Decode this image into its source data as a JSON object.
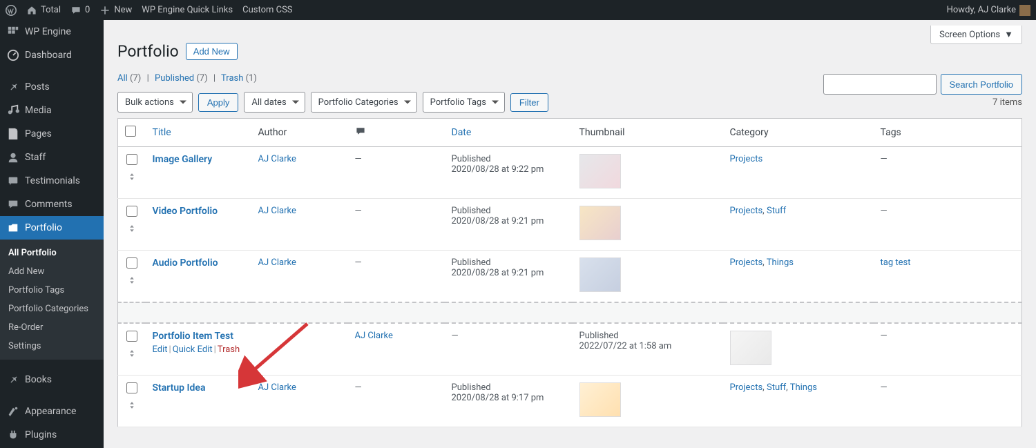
{
  "adminbar": {
    "site_name": "Total",
    "comments": "0",
    "new_label": "New",
    "quicklinks": "WP Engine Quick Links",
    "custom_css": "Custom CSS",
    "howdy": "Howdy, AJ Clarke"
  },
  "sidebar": {
    "items": [
      {
        "label": "WP Engine",
        "icon": "wpengine"
      },
      {
        "label": "Dashboard",
        "icon": "dashboard"
      },
      {
        "label": "Posts",
        "icon": "pin"
      },
      {
        "label": "Media",
        "icon": "media"
      },
      {
        "label": "Pages",
        "icon": "page"
      },
      {
        "label": "Staff",
        "icon": "user"
      },
      {
        "label": "Testimonials",
        "icon": "testimonial"
      },
      {
        "label": "Comments",
        "icon": "comment"
      },
      {
        "label": "Portfolio",
        "icon": "portfolio"
      },
      {
        "label": "Books",
        "icon": "pin"
      },
      {
        "label": "Appearance",
        "icon": "appearance"
      },
      {
        "label": "Plugins",
        "icon": "plugin"
      }
    ],
    "submenu": [
      {
        "label": "All Portfolio",
        "current": true
      },
      {
        "label": "Add New"
      },
      {
        "label": "Portfolio Tags"
      },
      {
        "label": "Portfolio Categories"
      },
      {
        "label": "Re-Order"
      },
      {
        "label": "Settings"
      }
    ]
  },
  "header": {
    "title": "Portfolio",
    "add_new": "Add New",
    "screen_options": "Screen Options"
  },
  "views": {
    "all": "All",
    "all_count": "(7)",
    "published": "Published",
    "published_count": "(7)",
    "trash": "Trash",
    "trash_count": "(1)"
  },
  "tablenav": {
    "bulk": "Bulk actions",
    "apply": "Apply",
    "dates": "All dates",
    "cats": "Portfolio Categories",
    "tags": "Portfolio Tags",
    "filter": "Filter",
    "items": "7 items"
  },
  "search": {
    "button": "Search Portfolio",
    "placeholder": ""
  },
  "columns": {
    "title": "Title",
    "author": "Author",
    "date": "Date",
    "thumb": "Thumbnail",
    "cat": "Category",
    "tags": "Tags"
  },
  "row_actions": {
    "edit": "Edit",
    "quick_edit": "Quick Edit",
    "trash": "Trash"
  },
  "rows": [
    {
      "title": "Image Gallery",
      "author": "AJ Clarke",
      "comments": "—",
      "date_status": "Published",
      "date": "2020/08/28 at 9:22 pm",
      "categories": [
        "Projects"
      ],
      "tags": "—",
      "thumb": "t1",
      "show_actions": false
    },
    {
      "title": "Video Portfolio",
      "author": "AJ Clarke",
      "comments": "—",
      "date_status": "Published",
      "date": "2020/08/28 at 9:21 pm",
      "categories": [
        "Projects",
        "Stuff"
      ],
      "tags": "—",
      "thumb": "t2",
      "show_actions": false
    },
    {
      "title": "Audio Portfolio",
      "author": "AJ Clarke",
      "comments": "—",
      "date_status": "Published",
      "date": "2020/08/28 at 9:21 pm",
      "categories": [
        "Projects",
        "Things"
      ],
      "tags": "tag test",
      "tags_link": true,
      "thumb": "t3",
      "show_actions": false
    },
    {
      "spacer": true
    },
    {
      "title": "Portfolio Item Test",
      "author": "AJ Clarke",
      "comments": "—",
      "date_status": "Published",
      "date": "2022/07/22 at 1:58 am",
      "categories_dash": true,
      "tags": "—",
      "thumb": "t4",
      "show_actions": true,
      "shifted": true
    },
    {
      "title": "Startup Idea",
      "author": "AJ Clarke",
      "comments": "—",
      "date_status": "Published",
      "date": "2020/08/28 at 9:17 pm",
      "categories": [
        "Projects",
        "Stuff",
        "Things"
      ],
      "tags": "—",
      "thumb": "t5",
      "show_actions": false
    }
  ]
}
